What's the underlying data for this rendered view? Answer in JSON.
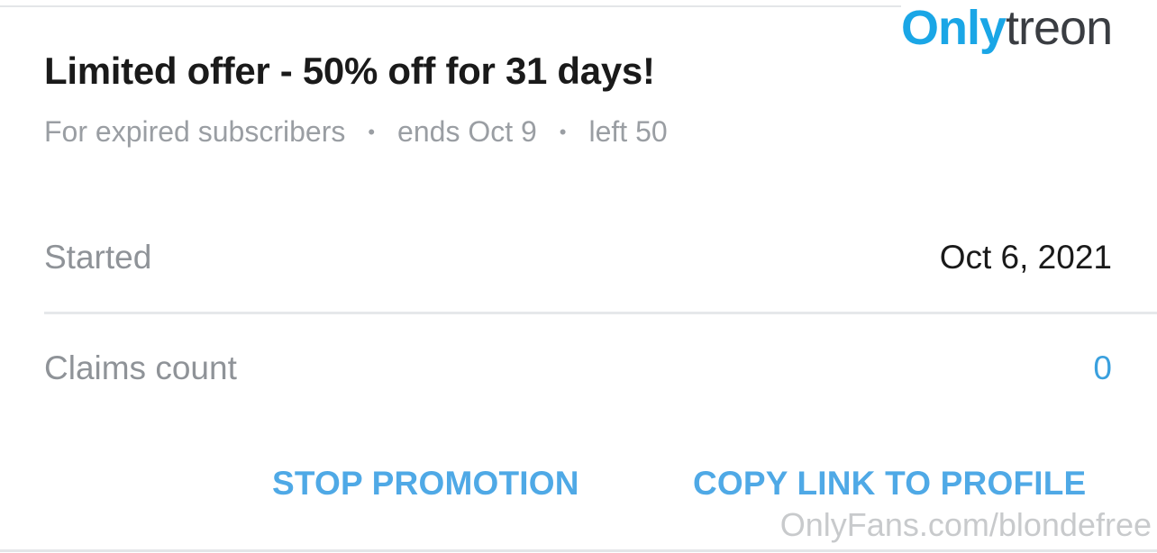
{
  "watermark": {
    "brand_part1": "Only",
    "brand_part2": "treon",
    "bottom_text": "OnlyFans.com/blondefree"
  },
  "offer": {
    "title": "Limited offer - 50% off for 31 days!",
    "audience": "For expired subscribers",
    "separator": "•",
    "ends": "ends Oct 9",
    "left": "left 50"
  },
  "details": {
    "started_label": "Started",
    "started_value": "Oct 6, 2021",
    "claims_label": "Claims count",
    "claims_value": "0"
  },
  "actions": {
    "stop_label": "STOP PROMOTION",
    "copy_label": "COPY LINK TO PROFILE"
  },
  "colors": {
    "accent_blue": "#4fa9e6",
    "brand_blue": "#1aa6e6",
    "muted_text": "#9a9ea3",
    "primary_text": "#1a1a1a"
  }
}
